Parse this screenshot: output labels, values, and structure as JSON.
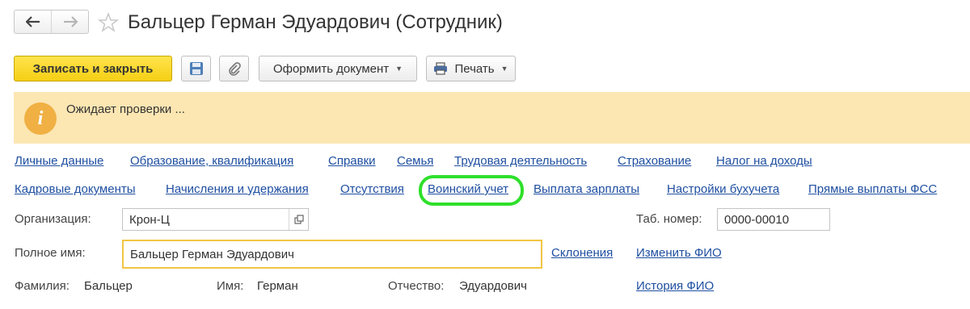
{
  "window": {
    "title": "Бальцер Герман Эдуардович (Сотрудник)"
  },
  "toolbar": {
    "save_close_label": "Записать и закрыть",
    "create_document_label": "Оформить документ",
    "print_label": "Печать"
  },
  "notice": {
    "icon_glyph": "i",
    "text": "Ожидает проверки ..."
  },
  "sections": {
    "row1": [
      "Личные данные",
      "Образование, квалификация",
      "Справки",
      "Семья",
      "Трудовая деятельность",
      "Страхование",
      "Налог на доходы"
    ],
    "row2": [
      "Кадровые документы",
      "Начисления и удержания",
      "Отсутствия",
      "Воинский учет",
      "Выплата зарплаты",
      "Настройки бухучета",
      "Прямые выплаты ФСС"
    ],
    "highlighted": "Воинский учет",
    "highlight_color": "#2ee02a"
  },
  "form": {
    "organization_label": "Организация:",
    "organization_value": "Крон-Ц",
    "tab_number_label": "Таб. номер:",
    "tab_number_value": "0000-00010",
    "full_name_label": "Полное имя:",
    "full_name_value": "Бальцер Герман Эдуардович",
    "declensions_link": "Склонения",
    "change_name_link": "Изменить ФИО",
    "surname_label": "Фамилия:",
    "surname_value": "Бальцер",
    "first_name_label": "Имя:",
    "first_name_value": "Герман",
    "patronymic_label": "Отчество:",
    "patronymic_value": "Эдуардович",
    "name_history_link": "История ФИО"
  },
  "colors": {
    "primary_button": "#f5cf14",
    "link": "#1f4fa1",
    "notice_background": "#fce6b2",
    "active_field_border": "#f1c542"
  }
}
